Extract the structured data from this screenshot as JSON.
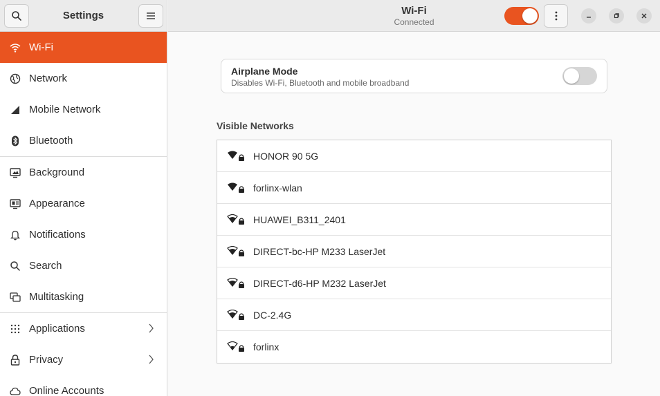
{
  "sidebar": {
    "title": "Settings",
    "items": [
      {
        "label": "Wi-Fi",
        "icon": "wifi-icon"
      },
      {
        "label": "Network",
        "icon": "globe-icon"
      },
      {
        "label": "Mobile Network",
        "icon": "cellular-icon"
      },
      {
        "label": "Bluetooth",
        "icon": "bluetooth-icon"
      },
      {
        "label": "Background",
        "icon": "display-icon"
      },
      {
        "label": "Appearance",
        "icon": "appearance-icon"
      },
      {
        "label": "Notifications",
        "icon": "bell-icon"
      },
      {
        "label": "Search",
        "icon": "search-icon"
      },
      {
        "label": "Multitasking",
        "icon": "multitasking-icon"
      },
      {
        "label": "Applications",
        "icon": "grid-icon"
      },
      {
        "label": "Privacy",
        "icon": "lock-icon"
      },
      {
        "label": "Online Accounts",
        "icon": "cloud-icon"
      }
    ],
    "active_index": 0
  },
  "header": {
    "title": "Wi-Fi",
    "subtitle": "Connected",
    "wifi_enabled": true
  },
  "airplane": {
    "title": "Airplane Mode",
    "subtitle": "Disables Wi-Fi, Bluetooth and mobile broadband",
    "enabled": false
  },
  "networks": {
    "label": "Visible Networks",
    "items": [
      {
        "ssid": "HONOR 90 5G",
        "secured": true
      },
      {
        "ssid": "forlinx-wlan",
        "secured": true
      },
      {
        "ssid": "HUAWEI_B311_2401",
        "secured": true
      },
      {
        "ssid": "DIRECT-bc-HP M233 LaserJet",
        "secured": true
      },
      {
        "ssid": "DIRECT-d6-HP M232 LaserJet",
        "secured": true
      },
      {
        "ssid": "DC-2.4G",
        "secured": true
      },
      {
        "ssid": "forlinx",
        "secured": true
      }
    ]
  },
  "colors": {
    "accent": "#e95420",
    "header_bg": "#ebebeb",
    "content_bg": "#fafafa"
  }
}
